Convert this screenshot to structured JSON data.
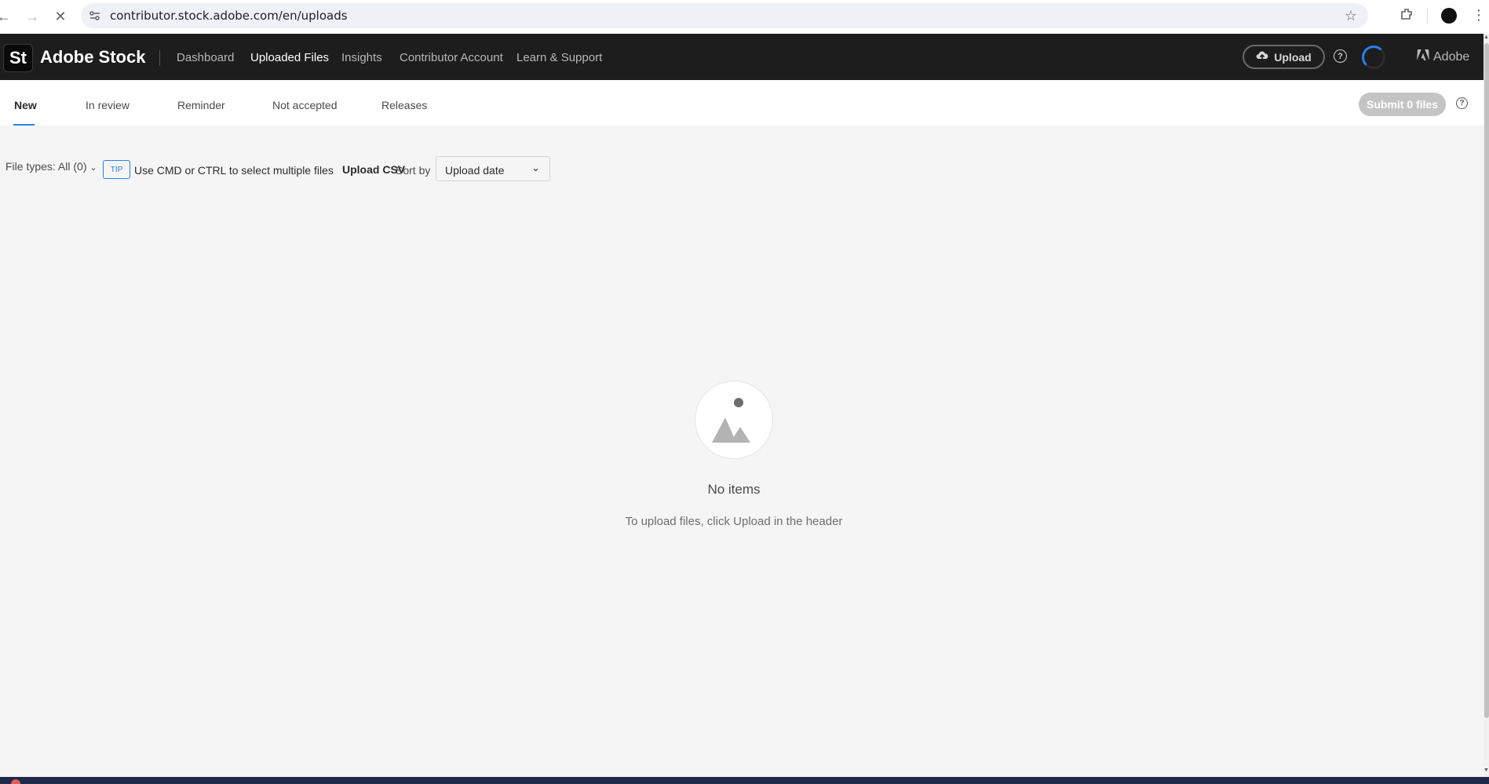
{
  "browser": {
    "url": "contributor.stock.adobe.com/en/uploads"
  },
  "header": {
    "logo_text": "St",
    "brand": "Adobe Stock",
    "nav": [
      "Dashboard",
      "Uploaded Files",
      "Insights",
      "Contributor Account",
      "Learn & Support"
    ],
    "active_nav": "Uploaded Files",
    "upload_label": "Upload",
    "help_glyph": "?",
    "adobe_label": "Adobe"
  },
  "tabs": {
    "items": [
      "New",
      "In review",
      "Reminder",
      "Not accepted",
      "Releases"
    ],
    "active": "New",
    "submit_label": "Submit 0 files",
    "help_glyph": "?"
  },
  "toolbar": {
    "file_types": "File types: All (0)",
    "tip_badge": "TIP",
    "tip_text": "Use CMD or CTRL to select multiple files",
    "upload_csv": "Upload CSV",
    "sort_label": "Sort by",
    "sort_value": "Upload date"
  },
  "empty_state": {
    "title": "No items",
    "subtitle": "To upload files, click Upload in the header",
    "icon": "image-placeholder-icon"
  },
  "colors": {
    "header_bg": "#1d1d1d",
    "accent": "#2680eb",
    "page_bg": "#f5f5f5",
    "submit_disabled": "#c4c4c4"
  }
}
